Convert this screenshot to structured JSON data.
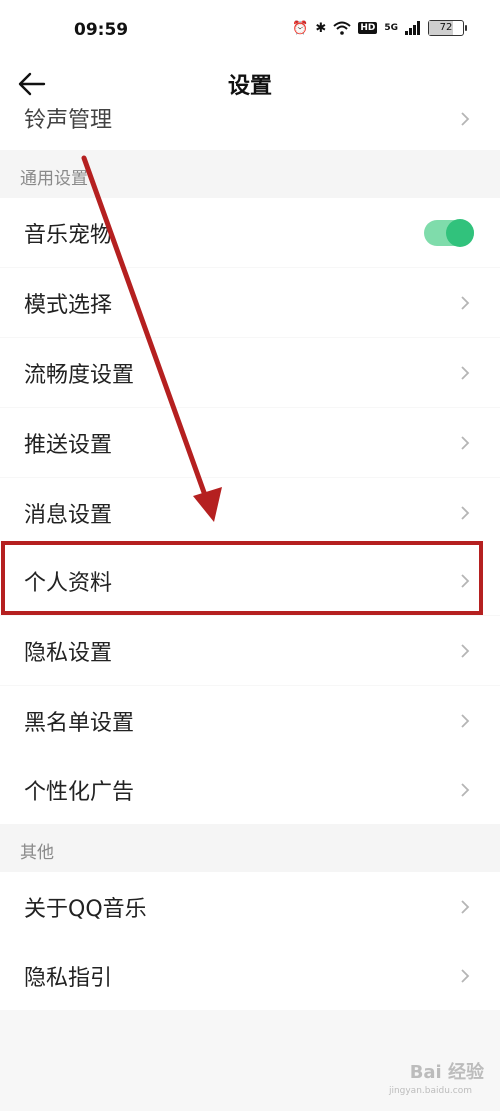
{
  "status_bar": {
    "time": "09:59",
    "battery": "72",
    "battery_level": 0.72,
    "network": "5G",
    "hd": "HD"
  },
  "header": {
    "title": "设置"
  },
  "partial_item": "铃声管理",
  "sections": {
    "general": {
      "title": "通用设置",
      "items": {
        "music_pet": "音乐宠物",
        "mode_select": "模式选择",
        "smoothness": "流畅度设置",
        "push": "推送设置",
        "message": "消息设置",
        "profile": "个人资料",
        "privacy": "隐私设置",
        "blacklist": "黑名单设置",
        "ads": "个性化广告"
      },
      "music_pet_enabled": true
    },
    "other": {
      "title": "其他",
      "items": {
        "about": "关于QQ音乐",
        "privacy_guide": "隐私指引"
      }
    }
  },
  "watermark": {
    "text": "Bai 经验",
    "sub": "jingyan.baidu.com"
  },
  "colors": {
    "accent": "#31c27c",
    "annotation": "#b52020"
  }
}
